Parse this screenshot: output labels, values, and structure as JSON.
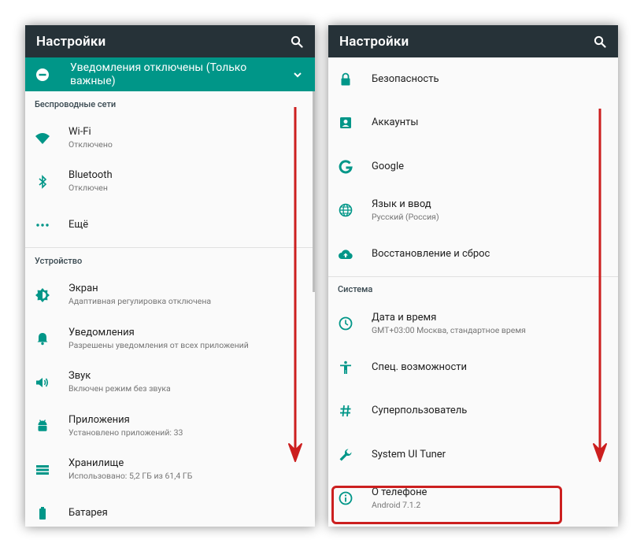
{
  "left": {
    "title": "Настройки",
    "banner": {
      "text": "Уведомления отключены (Только важные)"
    },
    "sections": [
      {
        "header": "Беспроводные сети",
        "items": [
          {
            "icon": "wifi-icon",
            "title": "Wi-Fi",
            "subtitle": "Отключено"
          },
          {
            "icon": "bluetooth-icon",
            "title": "Bluetooth",
            "subtitle": "Отключен"
          },
          {
            "icon": "more-icon",
            "title": "Ещё",
            "subtitle": ""
          }
        ]
      },
      {
        "header": "Устройство",
        "items": [
          {
            "icon": "brightness-icon",
            "title": "Экран",
            "subtitle": "Адаптивная регулировка отключена"
          },
          {
            "icon": "bell-icon",
            "title": "Уведомления",
            "subtitle": "Разрешены уведомления от всех приложений"
          },
          {
            "icon": "volume-icon",
            "title": "Звук",
            "subtitle": "Включен режим без звука"
          },
          {
            "icon": "android-icon",
            "title": "Приложения",
            "subtitle": "Установлено приложений: 33"
          },
          {
            "icon": "storage-icon",
            "title": "Хранилище",
            "subtitle": "Использовано: 5,2 ГБ из 61,4 ГБ"
          },
          {
            "icon": "battery-icon",
            "title": "Батарея",
            "subtitle": ""
          }
        ]
      }
    ]
  },
  "right": {
    "title": "Настройки",
    "items_top": [
      {
        "icon": "lock-icon",
        "title": "Безопасность",
        "subtitle": ""
      },
      {
        "icon": "account-icon",
        "title": "Аккаунты",
        "subtitle": ""
      },
      {
        "icon": "google-icon",
        "title": "Google",
        "subtitle": ""
      },
      {
        "icon": "globe-icon",
        "title": "Язык и ввод",
        "subtitle": "Русский (Россия)"
      },
      {
        "icon": "cloud-upload-icon",
        "title": "Восстановление и сброс",
        "subtitle": ""
      }
    ],
    "system_header": "Система",
    "items_system": [
      {
        "icon": "clock-icon",
        "title": "Дата и время",
        "subtitle": "GMT+03:00 Москва, стандартное время"
      },
      {
        "icon": "accessibility-icon",
        "title": "Спец. возможности",
        "subtitle": ""
      },
      {
        "icon": "hash-icon",
        "title": "Суперпользователь",
        "subtitle": ""
      },
      {
        "icon": "wrench-icon",
        "title": "System UI Tuner",
        "subtitle": ""
      },
      {
        "icon": "info-icon",
        "title": "О телефоне",
        "subtitle": "Android 7.1.2"
      }
    ]
  },
  "colors": {
    "accent": "#009688",
    "toolbar": "#263238",
    "arrow": "#cc1f1f"
  }
}
